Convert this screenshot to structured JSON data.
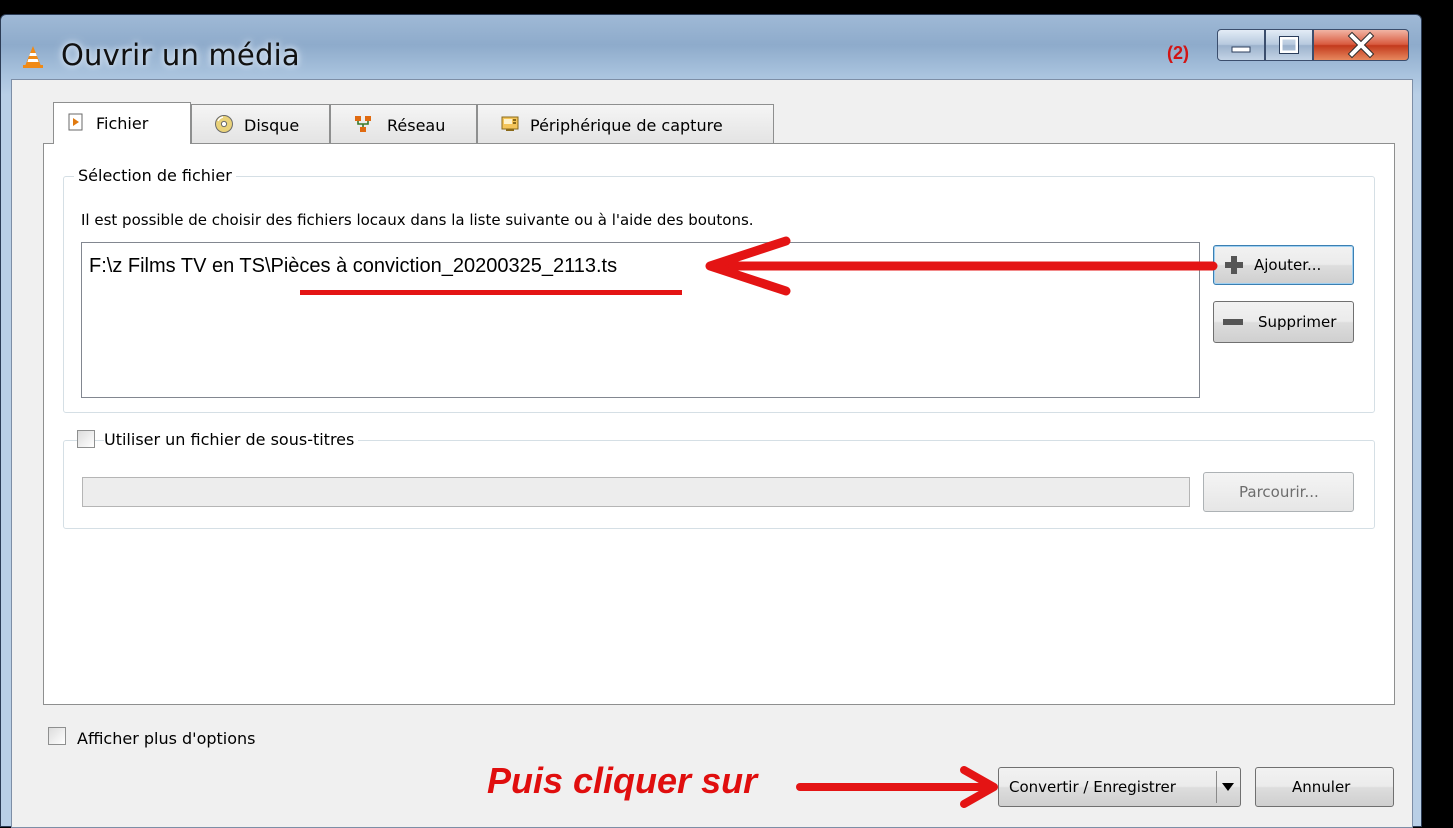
{
  "window": {
    "title": "Ouvrir un média",
    "step_label": "(2)",
    "controls": [
      "minimize-icon",
      "maximize-icon",
      "close-icon"
    ]
  },
  "tabs": [
    {
      "label": "Fichier",
      "icon": "file-play-icon",
      "active": true
    },
    {
      "label": "Disque",
      "icon": "disc-icon",
      "active": false
    },
    {
      "label": "Réseau",
      "icon": "network-icon",
      "active": false
    },
    {
      "label": "Périphérique de capture",
      "icon": "capture-device-icon",
      "active": false
    }
  ],
  "file_selection": {
    "group_title": "Sélection de fichier",
    "hint": "Il est possible de choisir des fichiers locaux dans la liste suivante ou à l'aide des boutons.",
    "files": [
      "F:\\z  Films TV en TS\\Pièces à conviction_20200325_2113.ts"
    ],
    "add_label": "Ajouter...",
    "remove_label": "Supprimer"
  },
  "subtitles": {
    "checkbox_label": "Utiliser un fichier de sous-titres",
    "checked": false,
    "path_value": "",
    "browse_label": "Parcourir..."
  },
  "options": {
    "more_options_label": "Afficher plus d'options",
    "checked": false
  },
  "actions": {
    "convert_label": "Convertir / Enregistrer",
    "cancel_label": "Annuler"
  },
  "annotations": {
    "instruction_text": "Puis cliquer sur",
    "color": "#e41414"
  },
  "colors": {
    "title_bar": "#9fb9d6",
    "close_button": "#c3391c",
    "dialog_bg": "#f0f0f0"
  }
}
